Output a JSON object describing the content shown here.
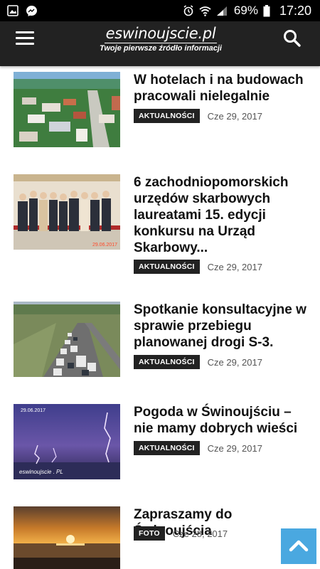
{
  "status_bar": {
    "battery_percent": "69%",
    "time": "17:20",
    "icons": [
      "gallery-icon",
      "messenger-icon",
      "alarm-icon",
      "wifi-icon",
      "signal-icon",
      "battery-icon"
    ]
  },
  "header": {
    "logo_title": "eswinoujscie.pl",
    "logo_subtitle": "Twoje pierwsze źródło informacji",
    "menu_icon": "hamburger-icon",
    "search_icon": "search-icon",
    "background": "#222222"
  },
  "articles": [
    {
      "title": "W hotelach i na budowach pracowali nielegalnie",
      "category": "AKTUALNOŚCI",
      "date": "Cze 29, 2017"
    },
    {
      "title": "6 zachodniopomorskich urzędów skarbowych laureatami 15. edycji konkursu na Urząd Skarbowy...",
      "category": "AKTUALNOŚCI",
      "date": "Cze 29, 2017",
      "image_caption": "29.06.2017"
    },
    {
      "title": "Spotkanie konsultacyjne w sprawie przebiegu planowanej drogi S-3.",
      "category": "AKTUALNOŚCI",
      "date": "Cze 29, 2017"
    },
    {
      "title": "Pogoda w Świnoujściu – nie mamy dobrych wieści",
      "category": "AKTUALNOŚCI",
      "date": "Cze 29, 2017",
      "image_date": "29.06.2017",
      "image_watermark": "eswinoujscie . PL"
    },
    {
      "title": "Zapraszamy do Świnoujścia",
      "category": "FOTO",
      "date": "Cze 28, 2017"
    }
  ],
  "scroll_top_button": {
    "icon": "chevron-up-icon",
    "color": "#4aa8e0"
  }
}
